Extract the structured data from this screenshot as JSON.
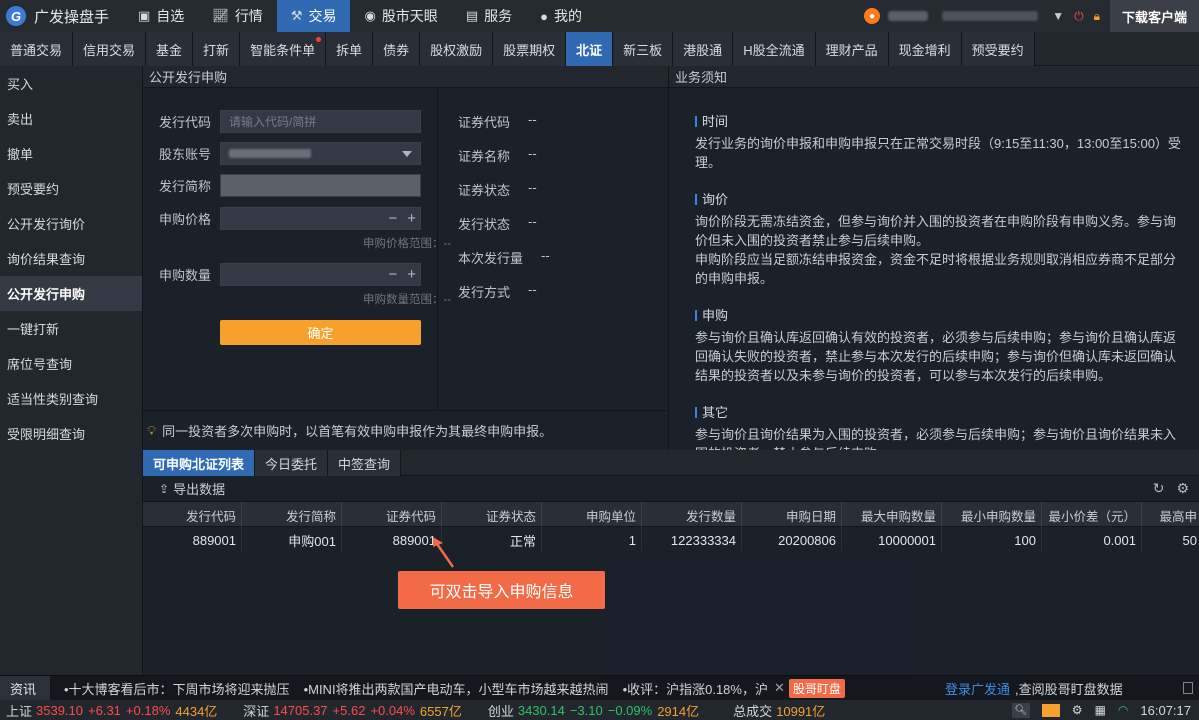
{
  "app": {
    "title": "广发操盘手",
    "logo_letter": "G"
  },
  "topnav": [
    {
      "label": "自选",
      "icon": "star-square-icon"
    },
    {
      "label": "行情",
      "icon": "chart-icon"
    },
    {
      "label": "交易",
      "icon": "bid-hammer-icon",
      "active": true
    },
    {
      "label": "股市天眼",
      "icon": "eye-icon"
    },
    {
      "label": "服务",
      "icon": "briefcase-icon"
    },
    {
      "label": "我的",
      "icon": "person-icon"
    }
  ],
  "download_label": "下载客户端",
  "tabs": [
    "普通交易",
    "信用交易",
    "基金",
    "打新",
    "智能条件单",
    "拆单",
    "债券",
    "股权激励",
    "股票期权",
    "北证",
    "新三板",
    "港股通",
    "H股全流通",
    "理财产品",
    "现金增利",
    "预受要约"
  ],
  "active_tab": "北证",
  "sidebar": [
    "买入",
    "卖出",
    "撤单",
    "预受要约",
    "公开发行询价",
    "询价结果查询",
    "公开发行申购",
    "一键打新",
    "席位号查询",
    "适当性类别查询",
    "受限明细查询"
  ],
  "active_sidebar": "公开发行申购",
  "form": {
    "panel_title": "公开发行申购",
    "code_label": "发行代码",
    "code_placeholder": "请输入代码/简拼",
    "account_label": "股东账号",
    "name_label": "发行简称",
    "price_label": "申购价格",
    "price_range": "申购价格范围：--",
    "qty_label": "申购数量",
    "qty_range": "申购数量范围：--",
    "confirm": "确定",
    "minus": "−",
    "plus": "+"
  },
  "info": [
    {
      "label": "证券代码",
      "value": "--"
    },
    {
      "label": "证券名称",
      "value": "--"
    },
    {
      "label": "证券状态",
      "value": "--"
    },
    {
      "label": "发行状态",
      "value": "--"
    },
    {
      "label": "本次发行量",
      "value": "--"
    },
    {
      "label": "发行方式",
      "value": "--"
    }
  ],
  "notice": "同一投资者多次申购时，以首笔有效申购申报作为其最终申购申报。",
  "rules": {
    "title": "业务须知",
    "sections": [
      {
        "title": "时间",
        "lines": [
          "发行业务的询价申报和申购申报只在正常交易时段（9:15至11:30，13:00至15:00）受理。"
        ]
      },
      {
        "title": "询价",
        "lines": [
          "询价阶段无需冻结资金，但参与询价并入围的投资者在申购阶段有申购义务。参与询价但未入围的投资者禁止参与后续申购。",
          "申购阶段应当足额冻结申报资金，资金不足时将根据业务规则取消相应券商不足部分的申购申报。"
        ]
      },
      {
        "title": "申购",
        "lines": [
          "参与询价且确认库返回确认有效的投资者，必须参与后续申购；参与询价且确认库返回确认失败的投资者，禁止参与本次发行的后续申购；参与询价但确认库未返回确认结果的投资者以及未参与询价的投资者，可以参与本次发行的后续申购。"
        ]
      },
      {
        "title": "其它",
        "lines": [
          "参与询价且询价结果为入围的投资者，必须参与后续申购；参与询价且询价结果未入围的投资者，禁止参与后续申购。"
        ]
      }
    ]
  },
  "bottom_tabs": [
    "可申购北证列表",
    "今日委托",
    "中签查询"
  ],
  "export_label": "导出数据",
  "table": {
    "columns": [
      "发行代码",
      "发行简称",
      "证券代码",
      "证券状态",
      "申购单位",
      "发行数量",
      "申购日期",
      "最大申购数量",
      "最小申购数量",
      "最小价差（元）",
      "最高申"
    ],
    "rows": [
      [
        "889001",
        "申购001",
        "889001",
        "正常",
        "1",
        "122333334",
        "20200806",
        "10000001",
        "100",
        "0.001",
        "50"
      ]
    ]
  },
  "callout": "可双击导入申购信息",
  "news": {
    "tag": "资讯",
    "items": [
      "•十大博客看后市：下周市场将迎来抛压",
      "•MINI将推出两款国产电动车，小型车市场越来越热闹",
      "•收评：沪指涨0.18%，沪"
    ],
    "close": "✕",
    "badge": "股哥盯盘",
    "login": "登录广发通",
    "login_rest": ",查阅股哥盯盘数据"
  },
  "status": {
    "sh": {
      "label": "上证",
      "price": "3539.10",
      "chg": "+6.31",
      "pct": "+0.18%",
      "vol": "4434亿"
    },
    "sz": {
      "label": "深证",
      "price": "14705.37",
      "chg": "+5.62",
      "pct": "+0.04%",
      "vol": "6557亿"
    },
    "cy": {
      "label": "创业",
      "price": "3430.14",
      "chg": "−3.10",
      "pct": "−0.09%",
      "vol": "2914亿"
    },
    "total_label": "总成交",
    "total": "10991亿",
    "time": "16:07:17"
  },
  "colors": {
    "accent": "#2f6ab2",
    "confirm": "#f7a02c",
    "callout": "#f26a46",
    "up": "#ff4b4b",
    "down": "#29c466"
  }
}
